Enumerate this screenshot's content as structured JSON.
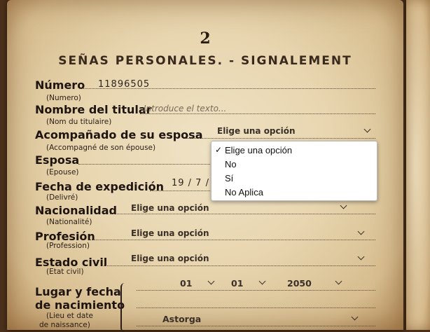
{
  "page_number": "2",
  "title": "SEÑAS PERSONALES. - SIGNALEMENT",
  "fields": {
    "numero": {
      "label": "Número",
      "sub": "(Numero)",
      "value": "11896505"
    },
    "nombre": {
      "label": "Nombre del titular",
      "sub": "(Nom du titulaire)",
      "placeholder": "Introduce el texto..."
    },
    "acompanado": {
      "label": "Acompañado de su esposa",
      "sub": "(Accompagné de son épouse)",
      "value": "Elige una opción"
    },
    "esposa": {
      "label": "Esposa",
      "sub": "(Epouse)"
    },
    "fecha_expedicion": {
      "label": "Fecha de expedición",
      "sub": "(Delivré)",
      "value": "19 / 7 / 2"
    },
    "nacionalidad": {
      "label": "Nacionalidad",
      "sub": "(Nationalité)",
      "value": "Elige una opción"
    },
    "profesion": {
      "label": "Profesión",
      "sub": "(Profession)",
      "value": "Elige una opción"
    },
    "estado_civil": {
      "label": "Estado civil",
      "sub": "(Etat civil)",
      "value": "Elige una opción"
    },
    "lugar_fecha": {
      "label_line1": "Lugar y fecha",
      "label_line2": "de nacimiento",
      "sub_line1": "(Lieu et date",
      "sub_line2": "de naissance)",
      "day": "01",
      "month": "01",
      "year": "2050",
      "place": "Astorga"
    }
  },
  "dropdown": {
    "options": [
      "Elige una opción",
      "No",
      "Sí",
      "No Aplica"
    ],
    "selected": "Elige una opción",
    "check_glyph": "✓"
  }
}
